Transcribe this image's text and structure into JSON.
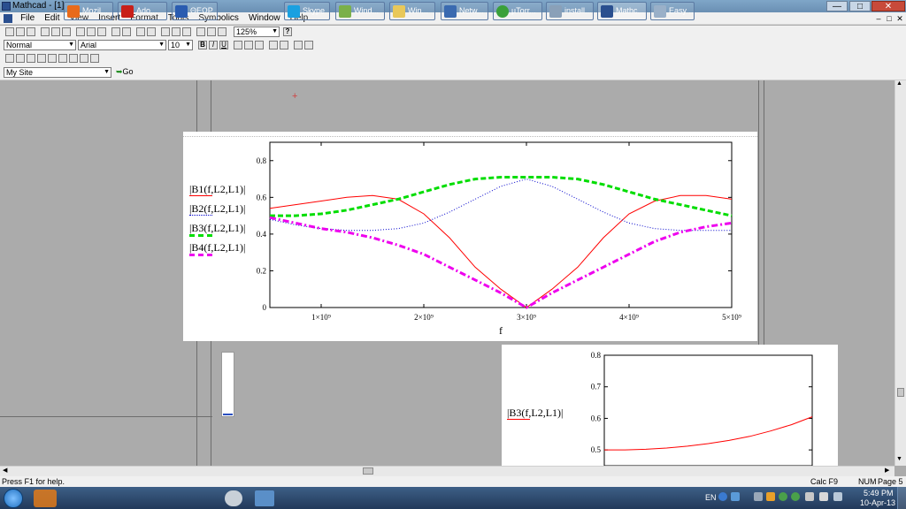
{
  "window": {
    "title": "Mathcad - [1]"
  },
  "menu": [
    "File",
    "Edit",
    "View",
    "Insert",
    "Format",
    "Tools",
    "Symbolics",
    "Window",
    "Help"
  ],
  "toolbar": {
    "zoom": "125%",
    "help_label": "?"
  },
  "format_bar": {
    "style": "Normal",
    "font": "Arial",
    "size": "10",
    "bold": "B",
    "italic": "I",
    "underline": "U"
  },
  "resource_bar": {
    "site": "My Site",
    "go_label": "Go"
  },
  "chart_data": [
    {
      "type": "line",
      "xlabel": "f",
      "x_tick_labels": [
        "1×10⁹",
        "2×10⁹",
        "3×10⁹",
        "4×10⁹",
        "5×10⁹"
      ],
      "x_ticks": [
        1000000000.0,
        2000000000.0,
        3000000000.0,
        4000000000.0,
        5000000000.0
      ],
      "y_tick_labels": [
        "0",
        "0.2",
        "0.4",
        "0.6",
        "0.8"
      ],
      "y_ticks": [
        0,
        0.2,
        0.4,
        0.6,
        0.8
      ],
      "xlim": [
        500000000.0,
        5000000000.0
      ],
      "ylim": [
        0,
        0.9
      ],
      "x": [
        500000000.0,
        750000000.0,
        1000000000.0,
        1250000000.0,
        1500000000.0,
        1750000000.0,
        2000000000.0,
        2250000000.0,
        2500000000.0,
        2750000000.0,
        3000000000.0,
        3250000000.0,
        3500000000.0,
        3750000000.0,
        4000000000.0,
        4250000000.0,
        4500000000.0,
        4750000000.0,
        5000000000.0
      ],
      "series": [
        {
          "name": "|B1(f,L2,L1)|",
          "color": "#ff0000",
          "style": "solid",
          "values": [
            0.54,
            0.56,
            0.58,
            0.6,
            0.61,
            0.59,
            0.51,
            0.38,
            0.22,
            0.1,
            0.0,
            0.1,
            0.22,
            0.38,
            0.51,
            0.58,
            0.61,
            0.61,
            0.59
          ]
        },
        {
          "name": "|B2(f,L2,L1)|",
          "color": "#0000cc",
          "style": "dotted",
          "values": [
            0.48,
            0.45,
            0.43,
            0.42,
            0.42,
            0.43,
            0.46,
            0.52,
            0.59,
            0.66,
            0.7,
            0.66,
            0.59,
            0.52,
            0.46,
            0.43,
            0.42,
            0.42,
            0.42
          ]
        },
        {
          "name": "|B3(f,L2,L1)|",
          "color": "#00dd00",
          "style": "dashed",
          "values": [
            0.5,
            0.5,
            0.51,
            0.53,
            0.56,
            0.59,
            0.63,
            0.67,
            0.7,
            0.71,
            0.71,
            0.71,
            0.7,
            0.67,
            0.63,
            0.59,
            0.56,
            0.53,
            0.5
          ]
        },
        {
          "name": "|B4(f,L2,L1)|",
          "color": "#ee00ee",
          "style": "dashdot",
          "values": [
            0.49,
            0.46,
            0.43,
            0.41,
            0.38,
            0.34,
            0.29,
            0.22,
            0.15,
            0.08,
            0.0,
            0.08,
            0.15,
            0.22,
            0.29,
            0.36,
            0.41,
            0.44,
            0.46
          ]
        }
      ]
    },
    {
      "type": "line",
      "y_tick_labels": [
        "0.5",
        "0.6",
        "0.7",
        "0.8"
      ],
      "y_ticks": [
        0.5,
        0.6,
        0.7,
        0.8
      ],
      "ylim": [
        0.45,
        0.8
      ],
      "xlim": [
        0,
        1
      ],
      "x": [
        0,
        0.1,
        0.2,
        0.3,
        0.4,
        0.5,
        0.6,
        0.7,
        0.8,
        0.9,
        1.0
      ],
      "series": [
        {
          "name": "|B3(f,L2,L1)|",
          "color": "#ff0000",
          "style": "solid",
          "values": [
            0.5,
            0.5,
            0.502,
            0.506,
            0.512,
            0.52,
            0.53,
            0.543,
            0.56,
            0.58,
            0.605
          ]
        }
      ]
    }
  ],
  "status": {
    "help": "Press F1 for help.",
    "calc": "Calc F9",
    "num": "NUM",
    "page": "Page 5"
  },
  "taskbar": {
    "items": [
      "Mozil...",
      "Ado...",
      "ΘΕΩΡ...",
      "Skype",
      "Wind...",
      "Win...",
      "Netw...",
      "µTorr...",
      "install...",
      "Mathc...",
      "Easy ..."
    ],
    "lang": "EN",
    "time": "5:49 PM",
    "date": "10-Apr-13"
  }
}
